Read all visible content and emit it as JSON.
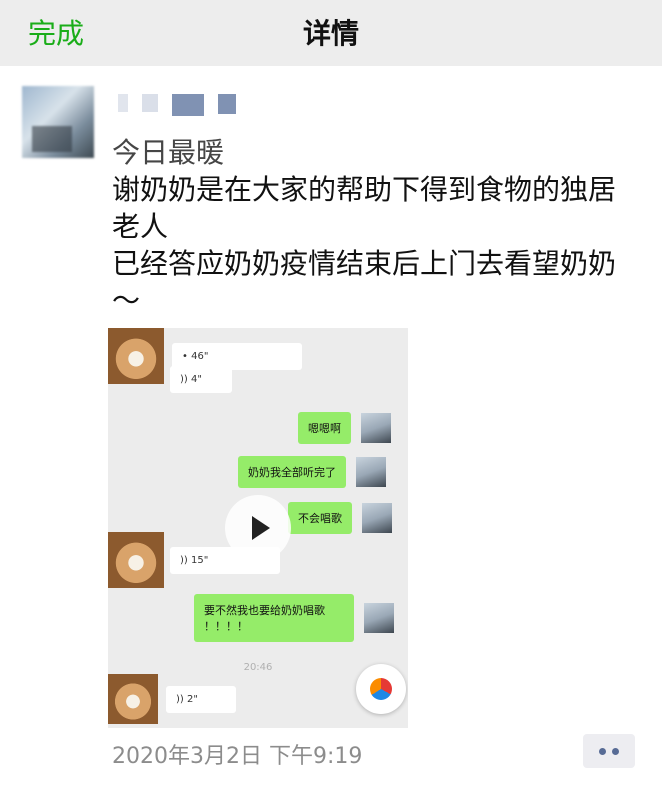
{
  "nav": {
    "done_label": "完成",
    "title": "详情"
  },
  "post": {
    "lines": [
      "今日最暖",
      "谢奶奶是在大家的帮助下得到食物的独居老人",
      "已经答应奶奶疫情结束后上门去看望奶奶～"
    ],
    "timestamp": "2020年3月2日 下午9:19"
  },
  "video_preview": {
    "messages": [
      {
        "side": "left",
        "type": "voice",
        "text": "46\""
      },
      {
        "side": "left",
        "type": "voice",
        "text": "4\""
      },
      {
        "side": "right",
        "type": "text",
        "text": "嗯嗯啊"
      },
      {
        "side": "right",
        "type": "text",
        "text": "奶奶我全部听完了"
      },
      {
        "side": "right",
        "type": "text",
        "text": "不会唱歌"
      },
      {
        "side": "left",
        "type": "voice",
        "text": "15\""
      },
      {
        "side": "right",
        "type": "text",
        "text": "要不然我也要给奶奶唱歌\n！！！！"
      },
      {
        "side": "left",
        "type": "voice",
        "text": "2\""
      }
    ],
    "time_divider": "20:46"
  },
  "icons": {
    "play": "play-icon",
    "more": "more-dots-icon",
    "fab": "floating-menu-icon"
  },
  "colors": {
    "accent_green": "#1aad19",
    "bubble_green": "#95ec69",
    "link_blue": "#576b95"
  }
}
